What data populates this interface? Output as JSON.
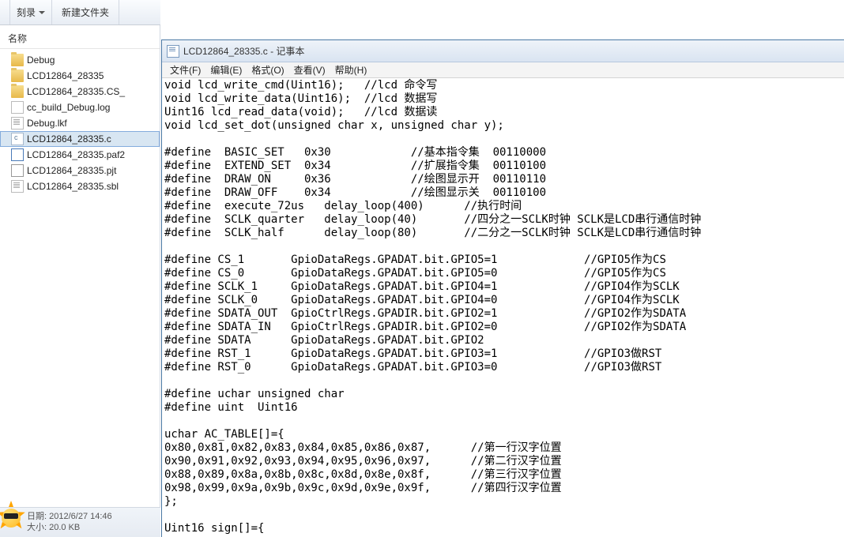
{
  "explorer": {
    "toolbar": {
      "burn": "刻录",
      "new_folder": "新建文件夹"
    },
    "column_header": "名称",
    "files": [
      {
        "name": "Debug",
        "icon": "folder",
        "selected": false
      },
      {
        "name": "LCD12864_28335",
        "icon": "folder",
        "selected": false
      },
      {
        "name": "LCD12864_28335.CS_",
        "icon": "folder",
        "selected": false
      },
      {
        "name": "cc_build_Debug.log",
        "icon": "log",
        "selected": false
      },
      {
        "name": "Debug.lkf",
        "icon": "txt",
        "selected": false
      },
      {
        "name": "LCD12864_28335.c",
        "icon": "c",
        "selected": true
      },
      {
        "name": "LCD12864_28335.paf2",
        "icon": "paf",
        "selected": false
      },
      {
        "name": "LCD12864_28335.pjt",
        "icon": "pjt",
        "selected": false
      },
      {
        "name": "LCD12864_28335.sbl",
        "icon": "txt",
        "selected": false
      }
    ],
    "status": {
      "date_label": "日期:",
      "date_value": "2012/6/27 14:46",
      "size_label": "大小:",
      "size_value": "20.0 KB"
    }
  },
  "notepad": {
    "title": "LCD12864_28335.c - 记事本",
    "menu": {
      "file": "文件(F)",
      "edit": "编辑(E)",
      "format": "格式(O)",
      "view": "查看(V)",
      "help": "帮助(H)"
    },
    "code": "void lcd_write_cmd(Uint16);   //lcd 命令写\nvoid lcd_write_data(Uint16);  //lcd 数据写\nUint16 lcd_read_data(void);   //lcd 数据读\nvoid lcd_set_dot(unsigned char x, unsigned char y);\n\n#define  BASIC_SET   0x30            //基本指令集  00110000\n#define  EXTEND_SET  0x34            //扩展指令集  00110100\n#define  DRAW_ON     0x36            //绘图显示开  00110110\n#define  DRAW_OFF    0x34            //绘图显示关  00110100\n#define  execute_72us   delay_loop(400)      //执行时间\n#define  SCLK_quarter   delay_loop(40)       //四分之一SCLK时钟 SCLK是LCD串行通信时钟\n#define  SCLK_half      delay_loop(80)       //二分之一SCLK时钟 SCLK是LCD串行通信时钟\n\n#define CS_1       GpioDataRegs.GPADAT.bit.GPIO5=1             //GPIO5作为CS\n#define CS_0       GpioDataRegs.GPADAT.bit.GPIO5=0             //GPIO5作为CS\n#define SCLK_1     GpioDataRegs.GPADAT.bit.GPIO4=1             //GPIO4作为SCLK\n#define SCLK_0     GpioDataRegs.GPADAT.bit.GPIO4=0             //GPIO4作为SCLK\n#define SDATA_OUT  GpioCtrlRegs.GPADIR.bit.GPIO2=1             //GPIO2作为SDATA\n#define SDATA_IN   GpioCtrlRegs.GPADIR.bit.GPIO2=0             //GPIO2作为SDATA\n#define SDATA      GpioDataRegs.GPADAT.bit.GPIO2\n#define RST_1      GpioDataRegs.GPADAT.bit.GPIO3=1             //GPIO3做RST\n#define RST_0      GpioDataRegs.GPADAT.bit.GPIO3=0             //GPIO3做RST\n\n#define uchar unsigned char\n#define uint  Uint16\n\nuchar AC_TABLE[]={\n0x80,0x81,0x82,0x83,0x84,0x85,0x86,0x87,      //第一行汉字位置\n0x90,0x91,0x92,0x93,0x94,0x95,0x96,0x97,      //第二行汉字位置\n0x88,0x89,0x8a,0x8b,0x8c,0x8d,0x8e,0x8f,      //第三行汉字位置\n0x98,0x99,0x9a,0x9b,0x9c,0x9d,0x9e,0x9f,      //第四行汉字位置\n};\n\nUint16 sign[]={"
  }
}
